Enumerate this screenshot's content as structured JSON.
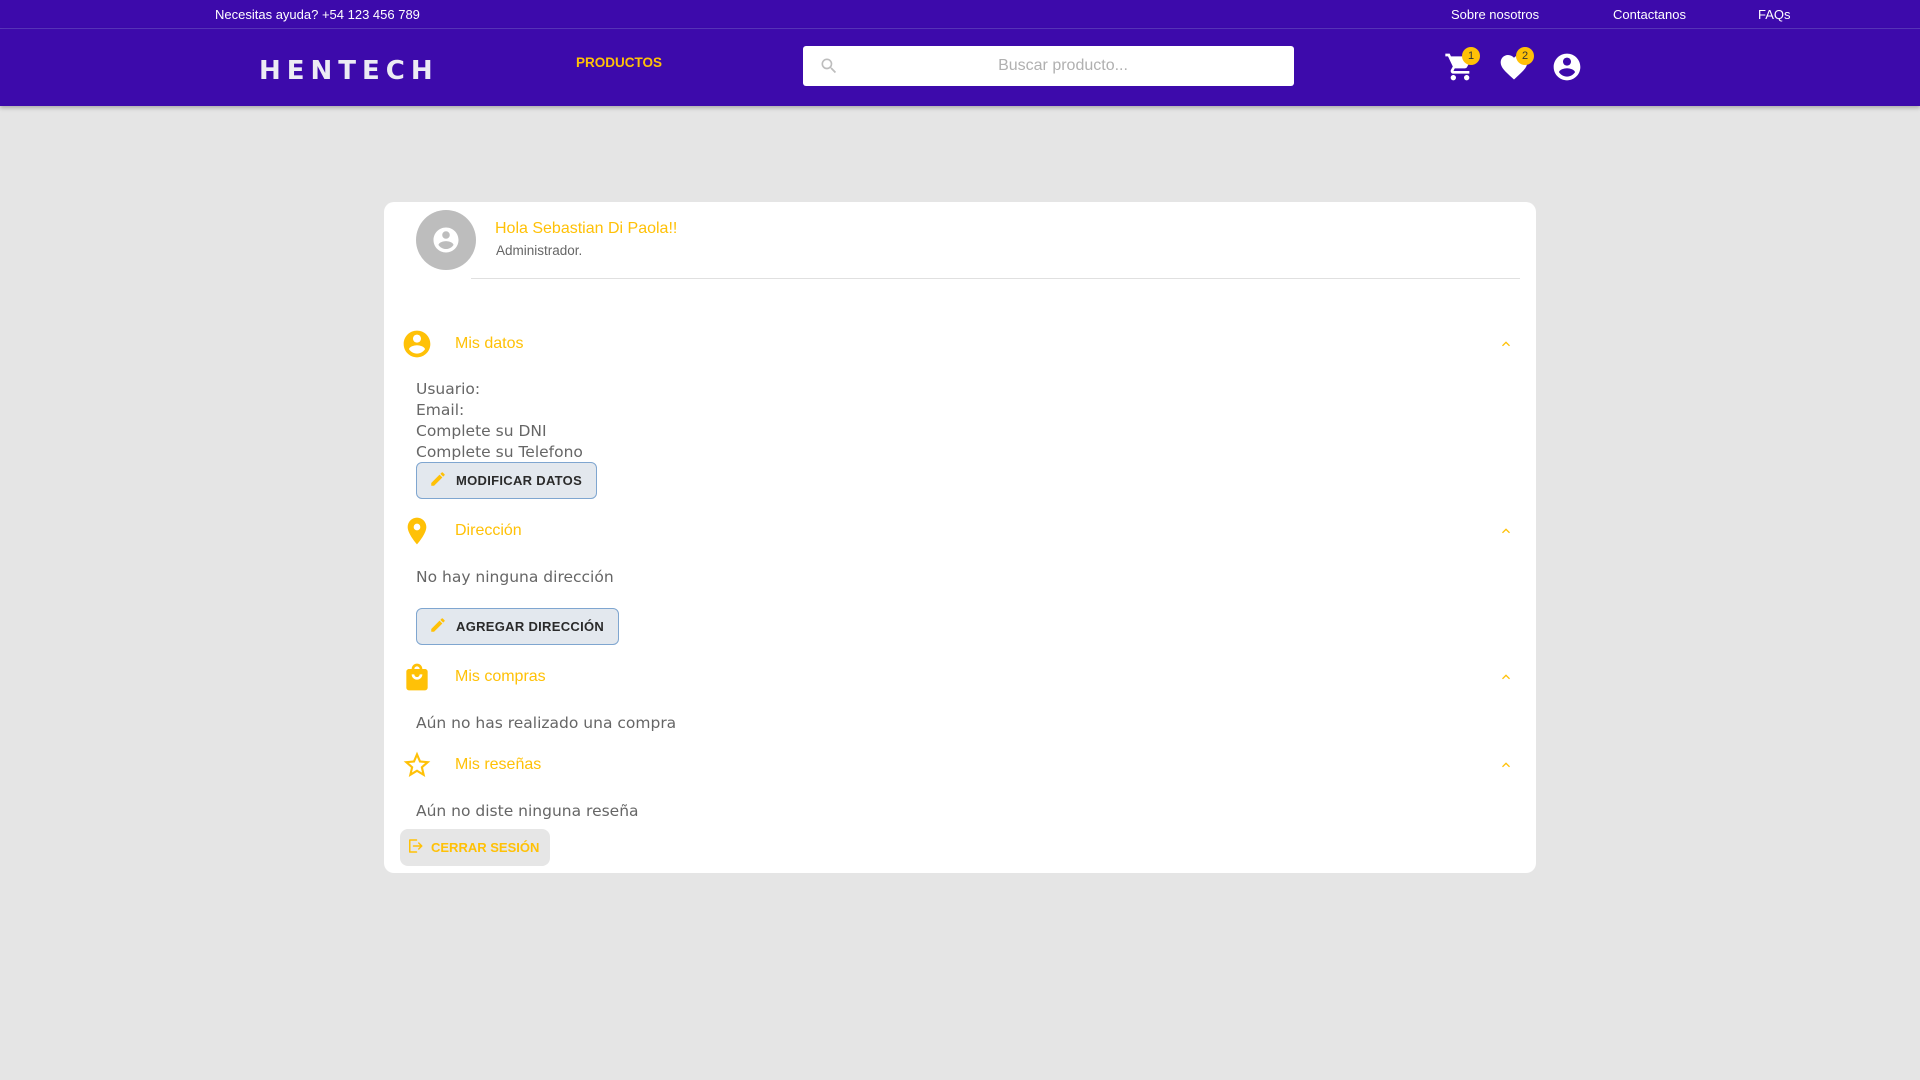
{
  "topbar": {
    "help": "Necesitas ayuda? +54 123 456 789",
    "links": [
      "Sobre nosotros",
      "Contactanos",
      "FAQs"
    ]
  },
  "navbar": {
    "logo": "HENTECH",
    "productos": "PRODUCTOS",
    "search_placeholder": "Buscar producto...",
    "cart_count": "1",
    "favorites_count": "2",
    "icons": [
      "cart-icon",
      "heart-icon",
      "account-circle-icon"
    ]
  },
  "profile": {
    "greeting": "Hola Sebastian Di Paola!!",
    "role": "Administrador."
  },
  "sections": {
    "datos": {
      "title": "Mis datos",
      "lines": [
        "Usuario:",
        "Email:",
        "Complete su DNI",
        "Complete su Telefono"
      ],
      "button": "MODIFICAR DATOS"
    },
    "direccion": {
      "title": "Dirección",
      "text": "No hay ninguna dirección",
      "button": "AGREGAR DIRECCIÓN"
    },
    "compras": {
      "title": "Mis compras",
      "text": "Aún no has realizado una compra"
    },
    "resenas": {
      "title": "Mis reseñas",
      "text": "Aún no diste ninguna reseña"
    }
  },
  "logout": "CERRAR SESIÓN",
  "colors": {
    "primary": "#3d0aab",
    "accent": "#ffc107",
    "page_bg": "#e5e5e5",
    "card_bg": "#ffffff"
  }
}
